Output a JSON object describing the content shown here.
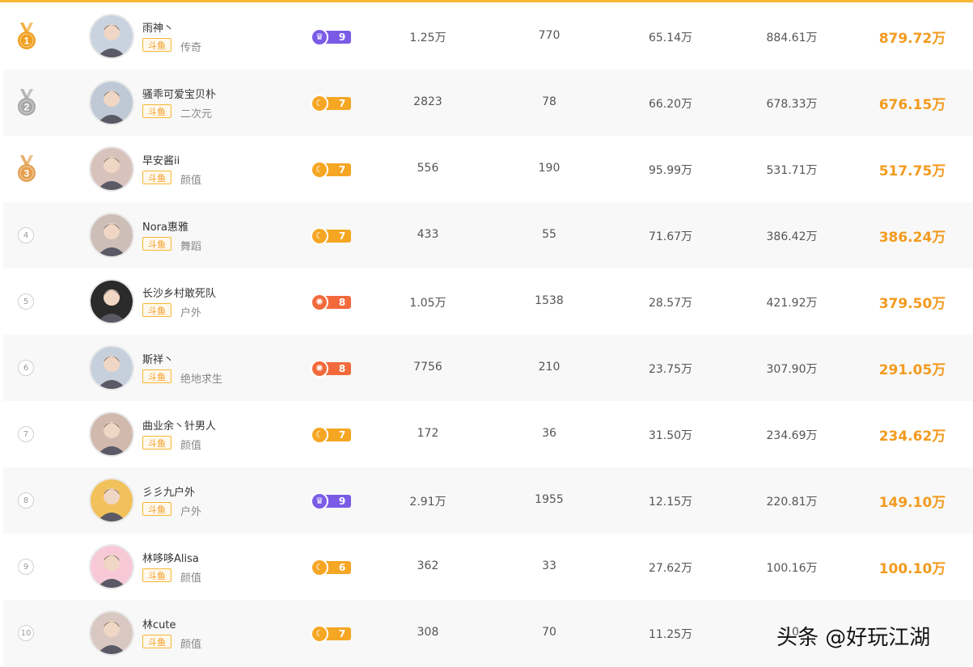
{
  "colors": {
    "accent": "#f39a1e",
    "gold": "#f0a020",
    "silver": "#a8a8a8",
    "bronze": "#e4a050",
    "level_purple": "#7b5be6",
    "level_orange": "#f5a623",
    "level_red": "#f26a3c"
  },
  "rows": [
    {
      "rank": "1",
      "medal": "gold",
      "name": "雨神丶",
      "platform": "斗鱼",
      "category": "传奇",
      "level": "9",
      "level_style": "purple",
      "stat1": "1.25万",
      "stat2": "770",
      "stat3": "65.14万",
      "stat4": "884.61万",
      "score": "879.72万"
    },
    {
      "rank": "2",
      "medal": "silver",
      "name": "骚乖可爱宝贝朴",
      "platform": "斗鱼",
      "category": "二次元",
      "level": "7",
      "level_style": "orange",
      "stat1": "2823",
      "stat2": "78",
      "stat3": "66.20万",
      "stat4": "678.33万",
      "score": "676.15万"
    },
    {
      "rank": "3",
      "medal": "bronze",
      "name": "早安酱ii",
      "platform": "斗鱼",
      "category": "颜值",
      "level": "7",
      "level_style": "orange",
      "stat1": "556",
      "stat2": "190",
      "stat3": "95.99万",
      "stat4": "531.71万",
      "score": "517.75万"
    },
    {
      "rank": "4",
      "medal": "",
      "name": "Nora惠雅",
      "platform": "斗鱼",
      "category": "舞蹈",
      "level": "7",
      "level_style": "orange",
      "stat1": "433",
      "stat2": "55",
      "stat3": "71.67万",
      "stat4": "386.42万",
      "score": "386.24万"
    },
    {
      "rank": "5",
      "medal": "",
      "name": "长沙乡村敢死队",
      "platform": "斗鱼",
      "category": "户外",
      "level": "8",
      "level_style": "red",
      "stat1": "1.05万",
      "stat2": "1538",
      "stat3": "28.57万",
      "stat4": "421.92万",
      "score": "379.50万"
    },
    {
      "rank": "6",
      "medal": "",
      "name": "斯祥丶",
      "platform": "斗鱼",
      "category": "绝地求生",
      "level": "8",
      "level_style": "red",
      "stat1": "7756",
      "stat2": "210",
      "stat3": "23.75万",
      "stat4": "307.90万",
      "score": "291.05万"
    },
    {
      "rank": "7",
      "medal": "",
      "name": "曲业余丶针男人",
      "platform": "斗鱼",
      "category": "颜值",
      "level": "7",
      "level_style": "orange",
      "stat1": "172",
      "stat2": "36",
      "stat3": "31.50万",
      "stat4": "234.69万",
      "score": "234.62万"
    },
    {
      "rank": "8",
      "medal": "",
      "name": "彡彡九户外",
      "platform": "斗鱼",
      "category": "户外",
      "level": "9",
      "level_style": "purple",
      "stat1": "2.91万",
      "stat2": "1955",
      "stat3": "12.15万",
      "stat4": "220.81万",
      "score": "149.10万"
    },
    {
      "rank": "9",
      "medal": "",
      "name": "林哆哆Alisa",
      "platform": "斗鱼",
      "category": "颜值",
      "level": "6",
      "level_style": "orange",
      "stat1": "362",
      "stat2": "33",
      "stat3": "27.62万",
      "stat4": "100.16万",
      "score": "100.10万"
    },
    {
      "rank": "10",
      "medal": "",
      "name": "林cute",
      "platform": "斗鱼",
      "category": "颜值",
      "level": "7",
      "level_style": "orange",
      "stat1": "308",
      "stat2": "70",
      "stat3": "11.25万",
      "stat4": "10",
      "score": ""
    }
  ],
  "watermark": "头条 @好玩江湖"
}
